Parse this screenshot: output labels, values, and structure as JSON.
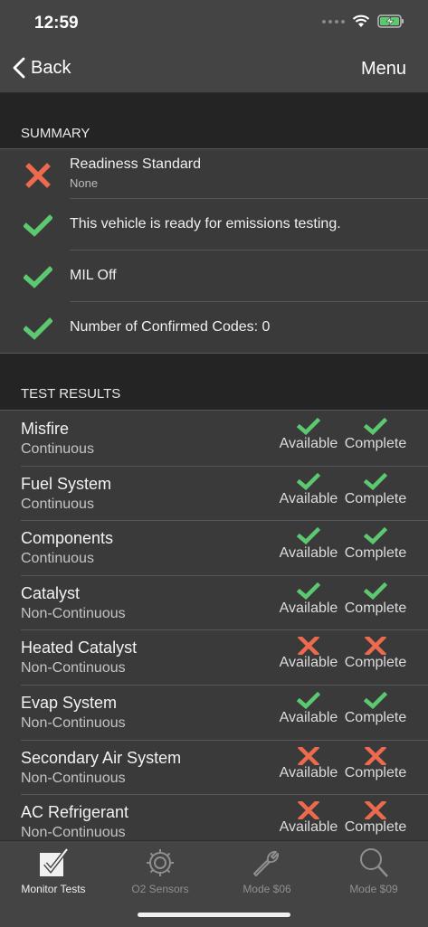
{
  "status_bar": {
    "time": "12:59"
  },
  "nav": {
    "back_label": "Back",
    "menu_label": "Menu"
  },
  "summary": {
    "header": "SUMMARY",
    "rows": [
      {
        "status": "fail",
        "text": "Readiness Standard",
        "subtext": "None"
      },
      {
        "status": "pass",
        "text": "This vehicle is ready for emissions testing."
      },
      {
        "status": "pass",
        "text": "MIL Off"
      },
      {
        "status": "pass",
        "text": "Number of Confirmed Codes: 0"
      }
    ]
  },
  "test_results": {
    "header": "TEST RESULTS",
    "available_label": "Available",
    "complete_label": "Complete",
    "rows": [
      {
        "name": "Misfire",
        "type": "Continuous",
        "available": true,
        "complete": true
      },
      {
        "name": "Fuel System",
        "type": "Continuous",
        "available": true,
        "complete": true
      },
      {
        "name": "Components",
        "type": "Continuous",
        "available": true,
        "complete": true
      },
      {
        "name": "Catalyst",
        "type": "Non-Continuous",
        "available": true,
        "complete": true
      },
      {
        "name": "Heated Catalyst",
        "type": "Non-Continuous",
        "available": false,
        "complete": false
      },
      {
        "name": "Evap System",
        "type": "Non-Continuous",
        "available": true,
        "complete": true
      },
      {
        "name": "Secondary Air System",
        "type": "Non-Continuous",
        "available": false,
        "complete": false
      },
      {
        "name": "AC Refrigerant",
        "type": "Non-Continuous",
        "available": false,
        "complete": false
      }
    ]
  },
  "tab_bar": {
    "tabs": [
      {
        "label": "Monitor Tests",
        "icon": "checkbox-icon",
        "active": true
      },
      {
        "label": "O2 Sensors",
        "icon": "gear-icon",
        "active": false
      },
      {
        "label": "Mode $06",
        "icon": "wrench-icon",
        "active": false
      },
      {
        "label": "Mode $09",
        "icon": "magnifier-icon",
        "active": false
      }
    ]
  },
  "colors": {
    "pass": "#5cc971",
    "fail": "#ee6a4f",
    "background": "#3a3a3a",
    "header": "#242424",
    "bar": "#444444"
  }
}
